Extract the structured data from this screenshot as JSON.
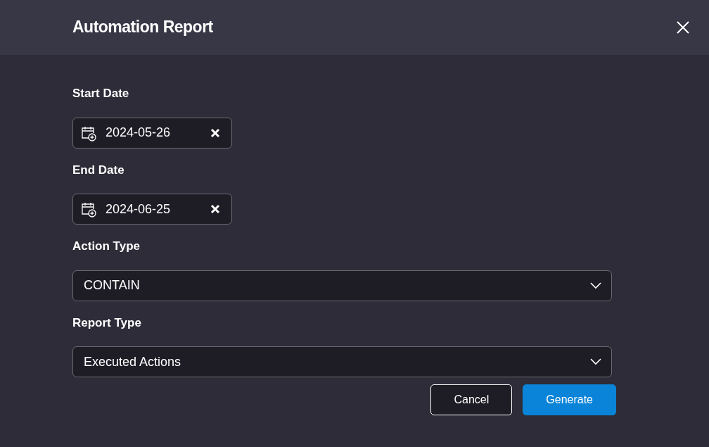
{
  "dialog": {
    "title": "Automation Report"
  },
  "fields": [
    {
      "kind": "date",
      "label": "Start Date",
      "value": "2024-05-26"
    },
    {
      "kind": "date",
      "label": "End Date",
      "value": "2024-06-25"
    },
    {
      "kind": "select",
      "label": "Action Type",
      "value": "CONTAIN"
    },
    {
      "kind": "select",
      "label": "Report Type",
      "value": "Executed Actions"
    }
  ],
  "buttons": [
    {
      "kind": "secondary",
      "label": "Cancel"
    },
    {
      "kind": "primary",
      "label": "Generate"
    }
  ]
}
